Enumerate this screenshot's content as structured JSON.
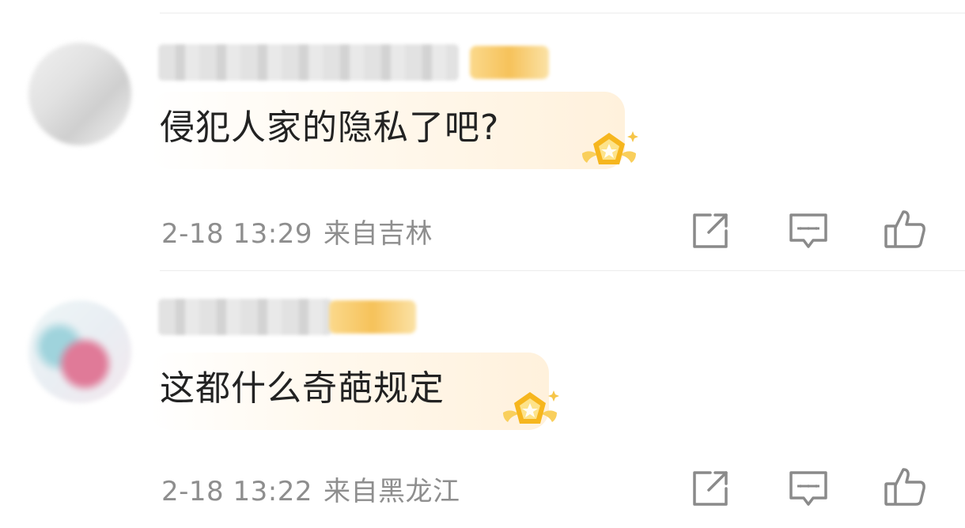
{
  "comments": [
    {
      "text": "侵犯人家的隐私了吧?",
      "time": "2-18 13:29",
      "location": "来自吉林"
    },
    {
      "text": "这都什么奇葩规定",
      "time": "2-18 13:22",
      "location": "来自黑龙江"
    }
  ],
  "icons": {
    "share": "share-icon",
    "reply": "reply-icon",
    "like": "like-icon",
    "medal": "star-medal-icon"
  },
  "colors": {
    "text": "#222222",
    "meta": "#8e8e8e",
    "icon": "#8a8a8a",
    "medal": "#f6b61e",
    "bubble": "#fff1dc"
  }
}
